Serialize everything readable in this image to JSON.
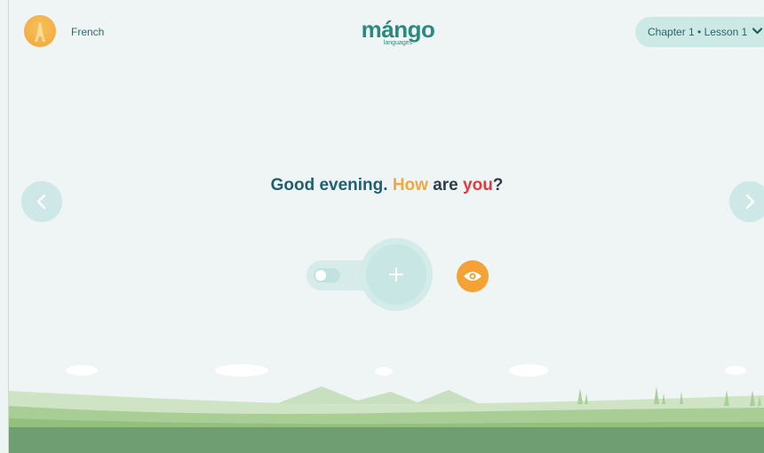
{
  "header": {
    "language": "French",
    "logo_word": "mángo",
    "logo_sub": "languages",
    "chapter_label": "Chapter 1 • Lesson 1"
  },
  "phrase": {
    "part1": "Good evening. ",
    "part2": "How",
    "part3": " are ",
    "part4": "you",
    "part5": "?"
  },
  "icons": {
    "avatar": "eiffel-tower-icon",
    "prev": "chevron-left-icon",
    "next": "chevron-right-icon",
    "chapter_dropdown": "chevron-down-icon",
    "record": "plus-icon",
    "reveal": "eye-icon"
  },
  "colors": {
    "primary": "#2a8a7f",
    "accent_orange": "#f0a93f",
    "accent_red": "#e43a3f",
    "dark_teal": "#1f5f70",
    "background": "#eef5f4"
  },
  "controls": {
    "toggle_state": "off"
  }
}
